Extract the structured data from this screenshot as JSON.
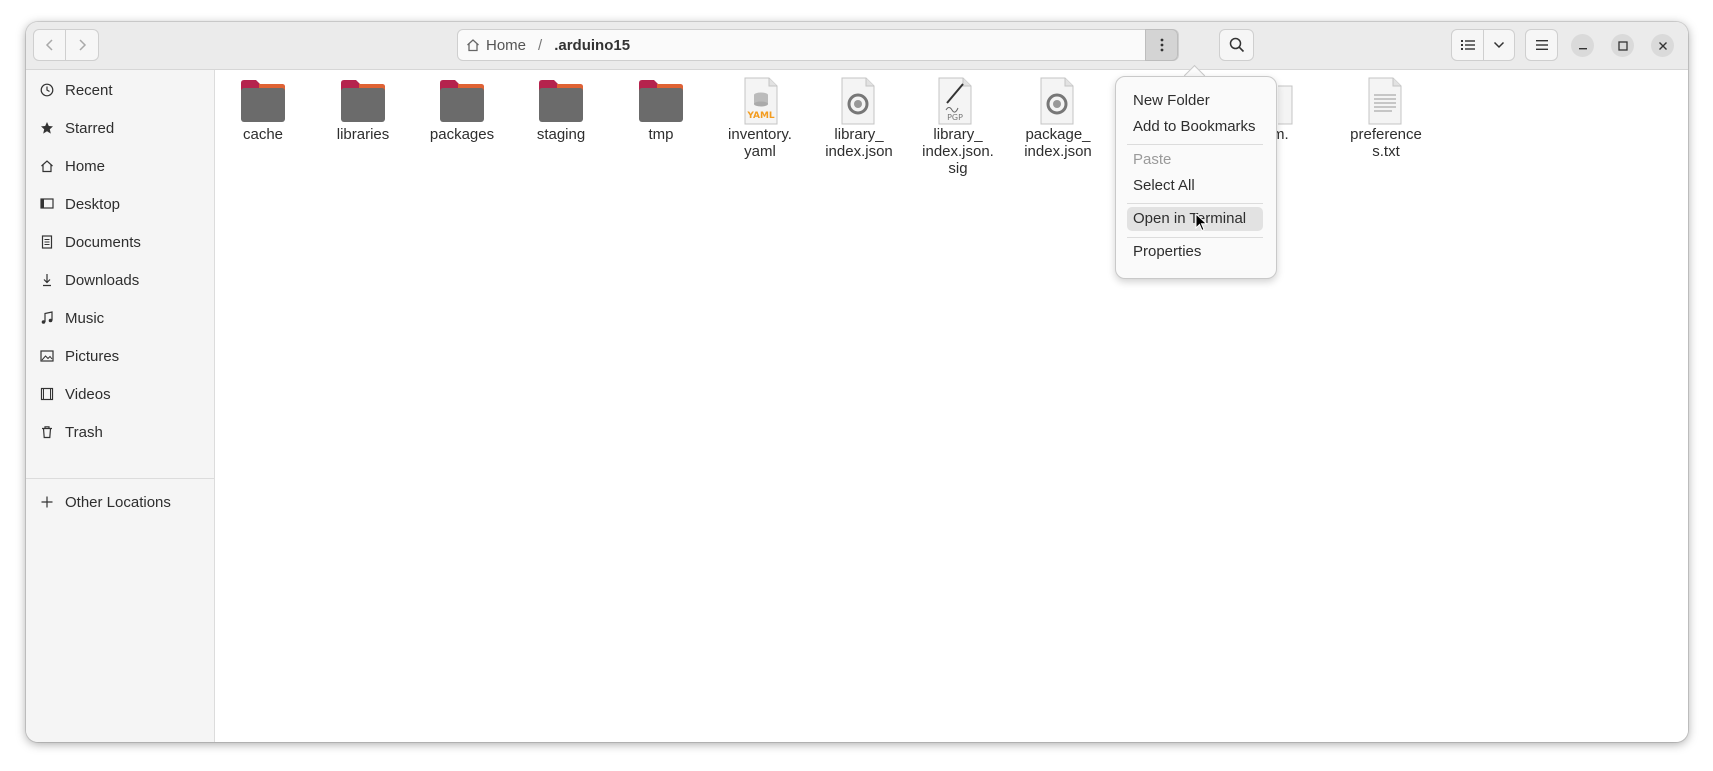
{
  "breadcrumb": {
    "home_label": "Home",
    "separator": "/",
    "current": ".arduino15"
  },
  "sidebar": {
    "items": [
      {
        "label": "Recent",
        "icon": "clock-icon"
      },
      {
        "label": "Starred",
        "icon": "star-icon"
      },
      {
        "label": "Home",
        "icon": "home-icon"
      },
      {
        "label": "Desktop",
        "icon": "desktop-icon"
      },
      {
        "label": "Documents",
        "icon": "documents-icon"
      },
      {
        "label": "Downloads",
        "icon": "download-icon"
      },
      {
        "label": "Music",
        "icon": "music-icon"
      },
      {
        "label": "Pictures",
        "icon": "pictures-icon"
      },
      {
        "label": "Videos",
        "icon": "videos-icon"
      },
      {
        "label": "Trash",
        "icon": "trash-icon"
      }
    ],
    "other_locations": "Other Locations"
  },
  "files": [
    {
      "name": "cache",
      "type": "folder"
    },
    {
      "name": "libraries",
      "type": "folder"
    },
    {
      "name": "packages",
      "type": "folder"
    },
    {
      "name": "staging",
      "type": "folder"
    },
    {
      "name": "tmp",
      "type": "folder"
    },
    {
      "name": "inventory.\nyaml",
      "type": "yaml"
    },
    {
      "name": "library_\nindex.json",
      "type": "json"
    },
    {
      "name": "library_\nindex.json.\nsig",
      "type": "pgp"
    },
    {
      "name": "package_\nindex.json",
      "type": "json"
    },
    {
      "name": "m.",
      "type": "hidden-partial"
    },
    {
      "name": "preference\ns.txt",
      "type": "text"
    }
  ],
  "context_menu": {
    "new_folder": "New Folder",
    "add_bookmark": "Add to Bookmarks",
    "paste": "Paste",
    "select_all": "Select All",
    "open_terminal": "Open in Terminal",
    "properties": "Properties"
  },
  "colors": {
    "folder_body": "#6b6b6b",
    "folder_tab": "#b5234d",
    "folder_tab_accent": "#e06334",
    "yaml_accent": "#f39c1f"
  }
}
